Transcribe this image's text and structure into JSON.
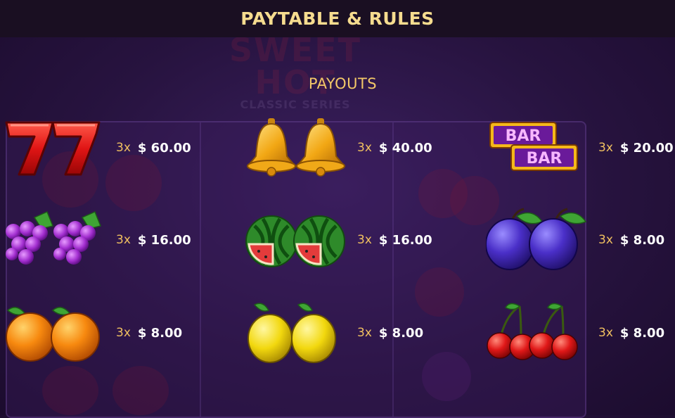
{
  "header": {
    "title": "PAYTABLE & RULES"
  },
  "section": {
    "title": "PAYOUTS"
  },
  "background": {
    "logo_line1": "SWEET",
    "logo_line2": "HOT",
    "logo_sub": "CLASSIC SERIES"
  },
  "payouts": [
    {
      "symbol": "seven-icon",
      "multiplier": "3x",
      "amount": "$ 60.00"
    },
    {
      "symbol": "bell-icon",
      "multiplier": "3x",
      "amount": "$ 40.00"
    },
    {
      "symbol": "bar-icon",
      "multiplier": "3x",
      "amount": "$ 20.00",
      "label": "BAR"
    },
    {
      "symbol": "grapes-icon",
      "multiplier": "3x",
      "amount": "$ 16.00"
    },
    {
      "symbol": "watermelon-icon",
      "multiplier": "3x",
      "amount": "$ 16.00"
    },
    {
      "symbol": "plum-icon",
      "multiplier": "3x",
      "amount": "$ 8.00"
    },
    {
      "symbol": "orange-icon",
      "multiplier": "3x",
      "amount": "$ 8.00"
    },
    {
      "symbol": "lemon-icon",
      "multiplier": "3x",
      "amount": "$ 8.00"
    },
    {
      "symbol": "cherry-icon",
      "multiplier": "3x",
      "amount": "$ 8.00"
    }
  ],
  "colors": {
    "header_text": "#f6dc8f",
    "section_text": "#f3c868",
    "multiplier_text": "#f0c060",
    "amount_text": "#ffffff",
    "background": "#27133f"
  }
}
